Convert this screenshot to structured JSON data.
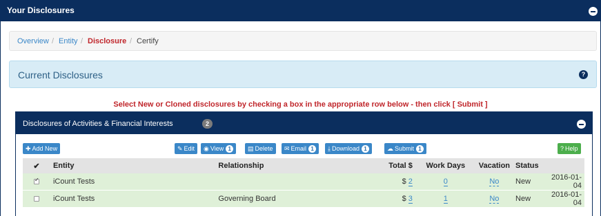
{
  "header": {
    "title": "Your Disclosures"
  },
  "breadcrumb": {
    "items": [
      "Overview",
      "Entity",
      "Disclosure",
      "Certify"
    ],
    "separator": "/"
  },
  "current_disclosures": {
    "label": "Current Disclosures",
    "help_glyph": "?"
  },
  "instruction": "Select New or Cloned disclosures by checking a box in the appropriate row below - then click [ Submit ]",
  "panel": {
    "title": "Disclosures of Activities & Financial Interests",
    "count": "2"
  },
  "toolbar": {
    "add_new": "Add New",
    "edit": "Edit",
    "view": "View",
    "view_count": "1",
    "delete": "Delete",
    "email": "Email",
    "email_count": "1",
    "download": "Download",
    "download_count": "1",
    "submit": "Submit",
    "submit_count": "1",
    "help": "Help"
  },
  "table": {
    "headers": {
      "check": "✔",
      "entity": "Entity",
      "relationship": "Relationship",
      "total": "Total $",
      "work_days": "Work Days",
      "vacation": "Vacation",
      "status": "Status"
    },
    "rows": [
      {
        "checked": true,
        "entity": "iCount Tests",
        "relationship": "",
        "currency": "$",
        "total": "2",
        "work_days": "0",
        "vacation": "No",
        "status": "New",
        "date": "2016-01-04"
      },
      {
        "checked": false,
        "entity": "iCount Tests",
        "relationship": "Governing Board",
        "currency": "$",
        "total": "3",
        "work_days": "1",
        "vacation": "No",
        "status": "New",
        "date": "2016-01-04"
      }
    ]
  },
  "colors": {
    "navy": "#0b2e5e",
    "link": "#3a87c8",
    "alert": "#c0262b",
    "row_green": "#dff0d8",
    "help_green": "#4cae4c",
    "info_blue": "#d8ecf6"
  }
}
